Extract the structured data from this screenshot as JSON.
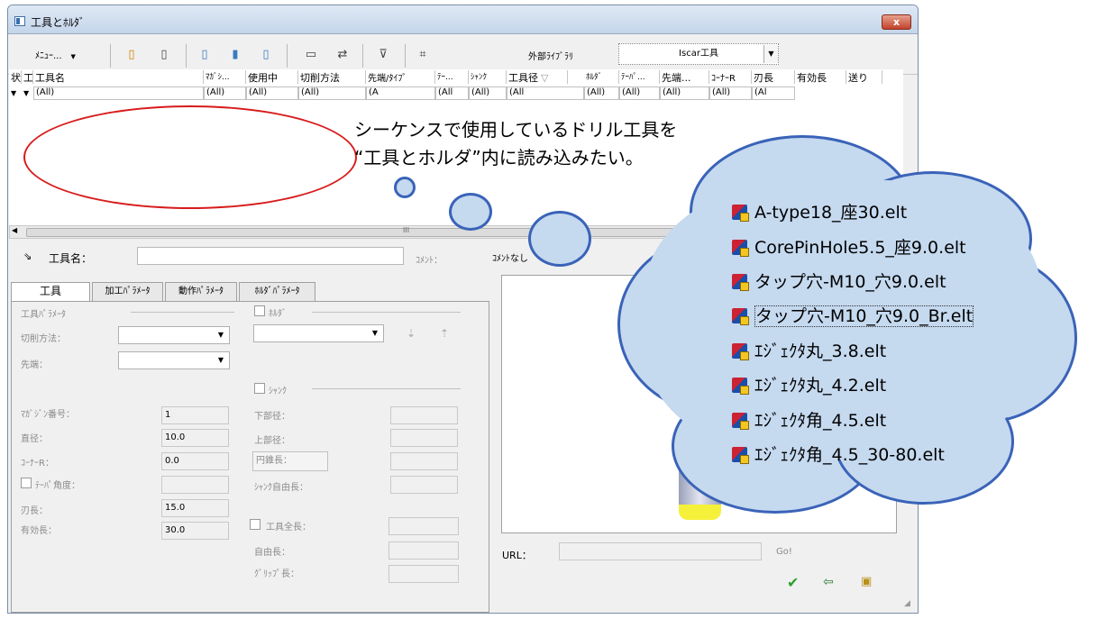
{
  "window": {
    "title": "工具とﾎﾙﾀﾞ",
    "close_label": "x"
  },
  "toolbar": {
    "menu_label": "ﾒﾆｭｰ...",
    "external_library_label": "外部ﾗｲﾌﾞﾗﾘ",
    "library_selected": "Iscar工具"
  },
  "grid": {
    "headers": [
      "状",
      "工",
      "工具名",
      "ﾏｶﾞｼ...",
      "使用中",
      "切削方法",
      "先端/ﾀｲﾌﾟ",
      "ﾃｰ...",
      "ｼｬﾝｸ",
      "工具径",
      "ﾎﾙﾀﾞ",
      "ﾃｰﾊﾟ...",
      "先端...",
      "ｺｰﾅｰR",
      "刃長",
      "有効長",
      "送り"
    ],
    "sort_indicator": "▽",
    "filters": [
      "(All)",
      "(All)",
      "(All)",
      "(All)",
      "(A",
      "(All",
      "(All)",
      "(All",
      "(All)",
      "(All)",
      "(All)",
      "(All)",
      "(Al"
    ],
    "hscroll_mid": "III"
  },
  "detail": {
    "tool_name_label": "工具名：",
    "tool_name_value": "",
    "comment_label": "ｺﾒﾝﾄ：",
    "comment_value": "ｺﾒﾝﾄなし"
  },
  "tabs": [
    "工具",
    "加工ﾊﾟﾗﾒｰﾀ",
    "動作ﾊﾟﾗﾒｰﾀ",
    "ﾎﾙﾀﾞﾊﾟﾗﾒｰﾀ"
  ],
  "tool_params": {
    "section_label": "工具ﾊﾟﾗﾒｰﾀ",
    "cutting_method_label": "切削方法：",
    "tip_label": "先端：",
    "magazine_label": "ﾏｶﾞｼﾞﾝ番号：",
    "magazine_value": "1",
    "diameter_label": "直径：",
    "diameter_value": "10.0",
    "corner_r_label": "ｺｰﾅｰR：",
    "corner_r_value": "0.0",
    "taper_angle_label": "ﾃｰﾊﾟ角度：",
    "blade_length_label": "刃長：",
    "blade_length_value": "15.0",
    "effective_length_label": "有効長：",
    "effective_length_value": "30.0"
  },
  "holder_params": {
    "holder_label": "ﾎﾙﾀﾞ",
    "shank_label": "ｼｬﾝｸ",
    "lower_diameter_label": "下部径：",
    "upper_diameter_label": "上部径：",
    "cone_length_label": "円錐長：",
    "shank_free_length_label": "ｼｬﾝｸ自由長：",
    "total_length_label": "工具全長：",
    "free_length_label": "自由長：",
    "grip_length_label": "ｸﾞﾘｯﾌﾟ長："
  },
  "footer": {
    "url_label": "URL：",
    "go_label": "Go!"
  },
  "annotation": {
    "line1": "シーケンスで使用しているドリル工具を",
    "line2": "“工具とホルダ”内に読み込みたい。"
  },
  "cloud_files": [
    "A-type18_座30.elt",
    "CorePinHole5.5_座9.0.elt",
    "タップ穴-M10_穴9.0.elt",
    "タップ穴-M10_穴9.0_Br.elt",
    "ｴｼﾞｪｸﾀ丸_3.8.elt",
    "ｴｼﾞｪｸﾀ丸_4.2.elt",
    "ｴｼﾞｪｸﾀ角_4.5.elt",
    "ｴｼﾞｪｸﾀ角_4.5_30-80.elt"
  ],
  "colors": {
    "annotation_ellipse": "#d81b1b",
    "cloud_fill": "#c5d9ef",
    "cloud_border": "#3a63b8",
    "tool_tip": "#f5f03a"
  }
}
